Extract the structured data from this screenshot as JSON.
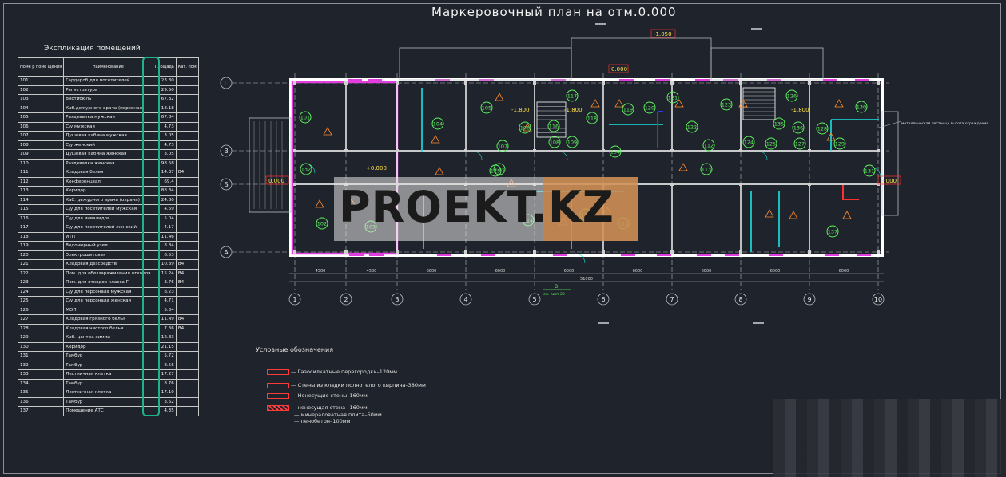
{
  "title": "Маркеровочный план на отм.0.000",
  "explication": {
    "title": "Экспликация помещений",
    "headers": {
      "num": "Номе р поме щения",
      "name": "Наименование",
      "area": "Площадь",
      "cat": "Кат. пом"
    },
    "rows": [
      {
        "num": "101",
        "name": "Гардероб для посетителей",
        "area": "23.30",
        "cat": ""
      },
      {
        "num": "102",
        "name": "Регистратура",
        "area": "29.50",
        "cat": ""
      },
      {
        "num": "103",
        "name": "Вестибюль",
        "area": "67.32",
        "cat": ""
      },
      {
        "num": "104",
        "name": "Каб.дежурного врача (персонал)",
        "area": "18.18",
        "cat": ""
      },
      {
        "num": "105",
        "name": "Раздевалка мужская",
        "area": "67.84",
        "cat": ""
      },
      {
        "num": "106",
        "name": "С/у мужская",
        "area": "4.73",
        "cat": ""
      },
      {
        "num": "107",
        "name": "Душевая кабина мужская",
        "area": "3.05",
        "cat": ""
      },
      {
        "num": "108",
        "name": "С/у женский",
        "area": "4.73",
        "cat": ""
      },
      {
        "num": "109",
        "name": "Душевая кабина женская",
        "area": "3.05",
        "cat": ""
      },
      {
        "num": "110",
        "name": "Раздевалка женская",
        "area": "98.58",
        "cat": ""
      },
      {
        "num": "111",
        "name": "Кладовая белья",
        "area": "14.37",
        "cat": "В4"
      },
      {
        "num": "112",
        "name": "Конференцзал",
        "area": "69.4",
        "cat": ""
      },
      {
        "num": "113",
        "name": "Коридор",
        "area": "88.34",
        "cat": ""
      },
      {
        "num": "114",
        "name": "Каб. дежурного врача (охрана)",
        "area": "24.80",
        "cat": ""
      },
      {
        "num": "115",
        "name": "С/у для посетителей мужская",
        "area": "4.69",
        "cat": ""
      },
      {
        "num": "116",
        "name": "С/у для инвалидов",
        "area": "5.04",
        "cat": ""
      },
      {
        "num": "117",
        "name": "С/у для посетителей женский",
        "area": "4.17",
        "cat": ""
      },
      {
        "num": "118",
        "name": "ИТП",
        "area": "11.46",
        "cat": ""
      },
      {
        "num": "119",
        "name": "Водомерный узел",
        "area": "8.84",
        "cat": ""
      },
      {
        "num": "120",
        "name": "Электрощитовая",
        "area": "8.53",
        "cat": ""
      },
      {
        "num": "121",
        "name": "Кладовая дезсредств",
        "area": "10.39",
        "cat": "В4"
      },
      {
        "num": "122",
        "name": "Пом. для обеззараживания отходов",
        "area": "15.24",
        "cat": "В4"
      },
      {
        "num": "123",
        "name": "Пом. для отходов класса Г",
        "area": "3.76",
        "cat": "В4"
      },
      {
        "num": "124",
        "name": "С/у для персонала мужская",
        "area": "8.23",
        "cat": ""
      },
      {
        "num": "125",
        "name": "С/у для персонала женская",
        "area": "4.71",
        "cat": ""
      },
      {
        "num": "126",
        "name": "МОП",
        "area": "5.34",
        "cat": ""
      },
      {
        "num": "127",
        "name": "Кладовая грязного белья",
        "area": "11.49",
        "cat": "В4"
      },
      {
        "num": "128",
        "name": "Кладовая чистого белья",
        "area": "7.36",
        "cat": "В4"
      },
      {
        "num": "129",
        "name": "Каб. центра химии",
        "area": "12.33",
        "cat": ""
      },
      {
        "num": "130",
        "name": "Коридор",
        "area": "21.15",
        "cat": ""
      },
      {
        "num": "131",
        "name": "Тамбур",
        "area": "5.72",
        "cat": ""
      },
      {
        "num": "132",
        "name": "Тамбур",
        "area": "8.56",
        "cat": ""
      },
      {
        "num": "133",
        "name": "Лестничная клетка",
        "area": "17.27",
        "cat": ""
      },
      {
        "num": "134",
        "name": "Тамбур",
        "area": "8.76",
        "cat": ""
      },
      {
        "num": "135",
        "name": "Лестничная клетка",
        "area": "17.10",
        "cat": ""
      },
      {
        "num": "136",
        "name": "Тамбур",
        "area": "3.62",
        "cat": ""
      },
      {
        "num": "137",
        "name": "Помещение АТС",
        "area": "4.35",
        "cat": ""
      }
    ]
  },
  "plan": {
    "axes_letters": [
      "Г",
      "В",
      "Б",
      "А"
    ],
    "axes_numbers": [
      "1",
      "2",
      "3",
      "4",
      "5",
      "6",
      "7",
      "8",
      "9",
      "10"
    ],
    "spans": [
      "4500",
      "4500",
      "6000",
      "6000",
      "6000",
      "6000",
      "6000",
      "6000",
      "6000",
      "4500"
    ],
    "total_length": "51000",
    "elevations": {
      "top": "-1.050",
      "entrance_left": "0.000",
      "entrance_right": "0.000",
      "floor": "+0.000",
      "ramp": "0.000",
      "stair_left": "-1.800",
      "stair_right": "-1.800",
      "mid": "-1.800"
    },
    "room_labels": [
      "101",
      "102",
      "103",
      "104",
      "105",
      "106",
      "107",
      "108",
      "109",
      "110",
      "111",
      "112",
      "113",
      "114",
      "115",
      "116",
      "117",
      "118",
      "119",
      "120",
      "121",
      "122",
      "123",
      "124",
      "125",
      "126",
      "127",
      "128",
      "129",
      "130",
      "131",
      "132",
      "133",
      "134",
      "135",
      "136",
      "137"
    ],
    "note_right": "металлическая лестница высота ограждения",
    "section_mark": "В",
    "section_sub": "см. лист 20"
  },
  "legend": {
    "title": "Условные обозначения",
    "items": [
      "— Газосилкатные перегородки–120мм",
      "— Стены из кладки полнотелого кирпича–380мм",
      "— Ненесущие стены–160мм",
      "— ненесущая стена –160мм",
      "— минераловатная плита–50мм",
      "— пенобетон–100мм"
    ]
  },
  "watermark": "PROEKT.KZ",
  "colors": {
    "background": "#1f232b",
    "wall": "#ffffff",
    "partition_magenta": "#e23ddf",
    "cyan": "#19e3e3",
    "green": "#5df25d",
    "orange": "#ff8a2a",
    "red": "#ff3030",
    "blue": "#2c44ff",
    "grid": "#b9bcc4"
  }
}
